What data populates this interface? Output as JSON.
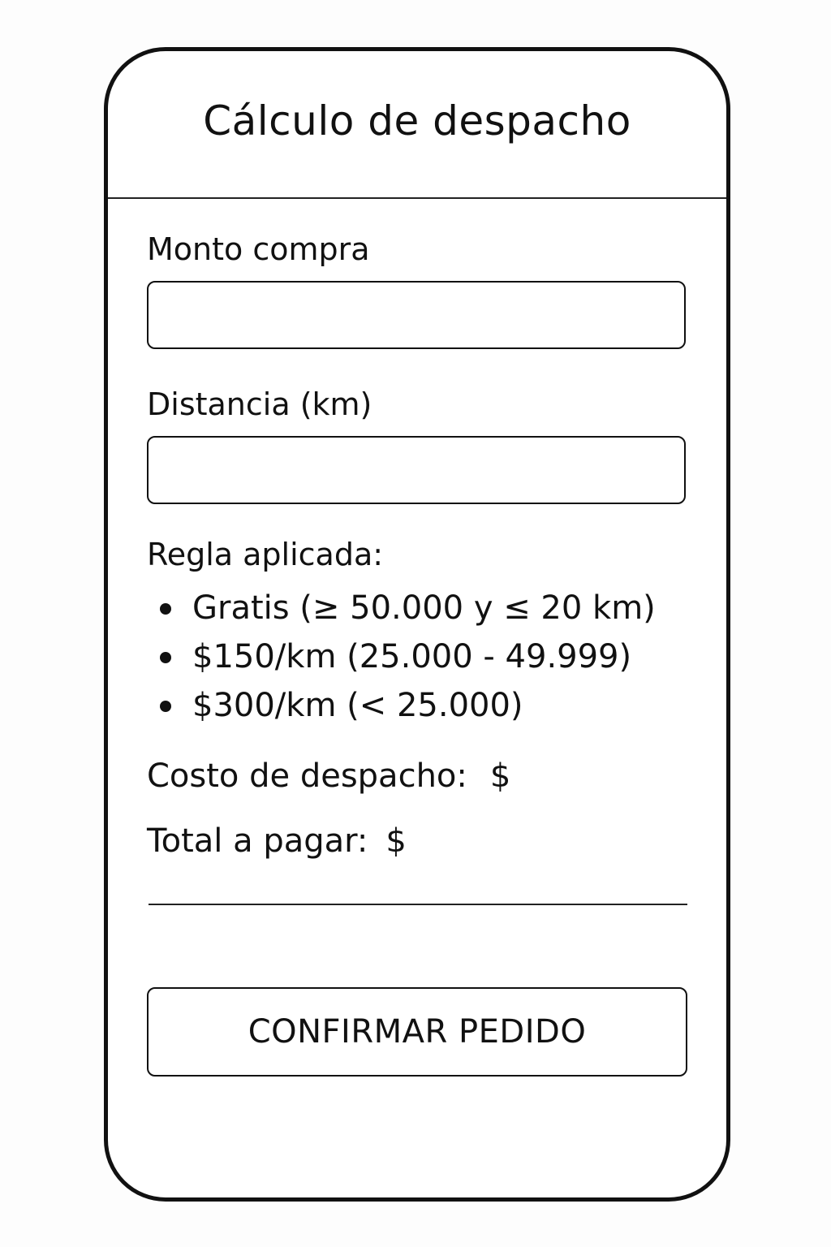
{
  "header": {
    "title": "Cálculo de despacho"
  },
  "form": {
    "amount_label": "Monto compra",
    "amount_value": "",
    "distance_label": "Distancia (km)",
    "distance_value": ""
  },
  "rules": {
    "title": "Regla aplicada:",
    "items": [
      "Gratis (≥ 50.000 y ≤ 20 km)",
      "$150/km (25.000 - 49.999)",
      "$300/km (< 25.000)"
    ]
  },
  "results": {
    "shipping_label": "Costo de despacho:",
    "shipping_value": "$",
    "total_label": "Total a pagar:",
    "total_value": "$"
  },
  "actions": {
    "confirm_label": "CONFIRMAR PEDIDO"
  },
  "colors": {
    "border": "#111111",
    "background": "#ffffff"
  }
}
